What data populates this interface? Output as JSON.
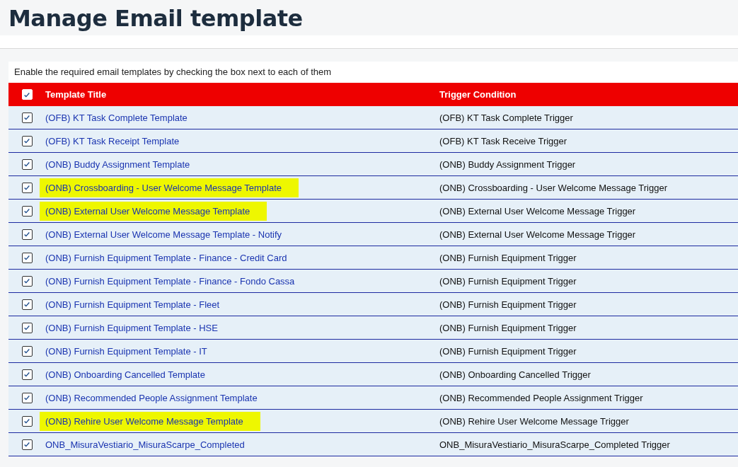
{
  "page": {
    "title": "Manage Email template"
  },
  "instructions": "Enable the required email templates by checking the box next to each of them",
  "table": {
    "select_all_checked": true,
    "columns": [
      "Template Title",
      "Trigger Condition"
    ],
    "rows": [
      {
        "checked": true,
        "highlighted": false,
        "title": "(OFB) KT Task Complete Template",
        "trigger": "(OFB) KT Task Complete Trigger"
      },
      {
        "checked": true,
        "highlighted": false,
        "title": "(OFB) KT Task Receipt Template",
        "trigger": "(OFB) KT Task Receive Trigger"
      },
      {
        "checked": true,
        "highlighted": false,
        "title": "(ONB) Buddy Assignment Template",
        "trigger": "(ONB) Buddy Assignment Trigger"
      },
      {
        "checked": true,
        "highlighted": true,
        "title": "(ONB) Crossboarding - User Welcome Message Template",
        "trigger": "(ONB) Crossboarding - User Welcome Message Trigger"
      },
      {
        "checked": true,
        "highlighted": true,
        "title": "(ONB) External User Welcome Message Template",
        "trigger": "(ONB) External User Welcome Message Trigger"
      },
      {
        "checked": true,
        "highlighted": false,
        "title": "(ONB) External User Welcome Message Template - Notify",
        "trigger": "(ONB) External User Welcome Message Trigger"
      },
      {
        "checked": true,
        "highlighted": false,
        "title": "(ONB) Furnish Equipment Template - Finance - Credit Card",
        "trigger": "(ONB) Furnish Equipment Trigger"
      },
      {
        "checked": true,
        "highlighted": false,
        "title": "(ONB) Furnish Equipment Template - Finance - Fondo Cassa",
        "trigger": "(ONB) Furnish Equipment Trigger"
      },
      {
        "checked": true,
        "highlighted": false,
        "title": "(ONB) Furnish Equipment Template - Fleet",
        "trigger": "(ONB) Furnish Equipment Trigger"
      },
      {
        "checked": true,
        "highlighted": false,
        "title": "(ONB) Furnish Equipment Template - HSE",
        "trigger": "(ONB) Furnish Equipment Trigger"
      },
      {
        "checked": true,
        "highlighted": false,
        "title": "(ONB) Furnish Equipment Template - IT",
        "trigger": "(ONB) Furnish Equipment Trigger"
      },
      {
        "checked": true,
        "highlighted": false,
        "title": "(ONB) Onboarding Cancelled Template",
        "trigger": "(ONB) Onboarding Cancelled Trigger"
      },
      {
        "checked": true,
        "highlighted": false,
        "title": "(ONB) Recommended People Assignment Template",
        "trigger": "(ONB) Recommended People Assignment Trigger"
      },
      {
        "checked": true,
        "highlighted": true,
        "title": "(ONB) Rehire User Welcome Message Template",
        "trigger": "(ONB) Rehire User Welcome Message Trigger"
      },
      {
        "checked": true,
        "highlighted": false,
        "title": "ONB_MisuraVestiario_MisuraScarpe_Completed",
        "trigger": "ONB_MisuraVestiario_MisuraScarpe_Completed Trigger"
      }
    ]
  }
}
